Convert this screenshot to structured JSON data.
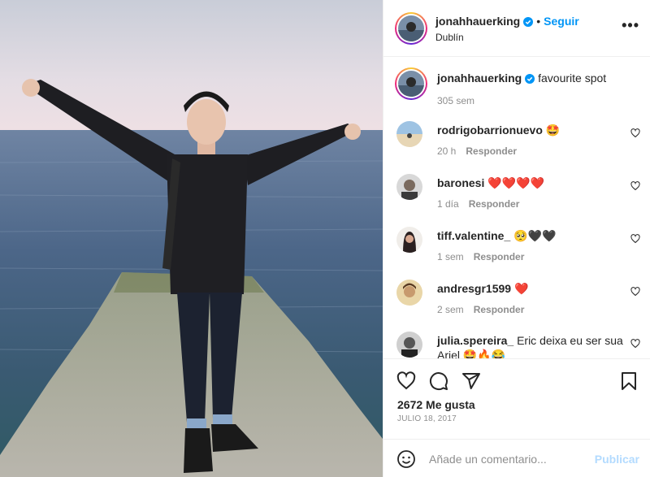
{
  "post": {
    "author": "jonahhauerking",
    "follow_label": "Seguir",
    "dot": "•",
    "location": "Dublín",
    "more": "•••"
  },
  "comments": [
    {
      "user": "jonahhauerking",
      "text": "favourite spot",
      "time": "305 sem",
      "reply": ""
    },
    {
      "user": "rodrigobarrionuevo",
      "text": "🤩",
      "time": "20 h",
      "reply": "Responder"
    },
    {
      "user": "baronesi",
      "text": "❤️❤️❤️❤️",
      "time": "1 día",
      "reply": "Responder"
    },
    {
      "user": "tiff.valentine_",
      "text": "🥺🖤🖤",
      "time": "1 sem",
      "reply": "Responder"
    },
    {
      "user": "andresgr1599",
      "text": "❤️",
      "time": "2 sem",
      "reply": "Responder"
    },
    {
      "user": "julia.spereira_",
      "text": "Eric deixa eu ser sua Ariel 🤩🔥😂",
      "time": "",
      "reply": ""
    }
  ],
  "footer": {
    "likes": "2672 Me gusta",
    "date": "JULIO 18, 2017",
    "comment_placeholder": "Añade un comentario...",
    "publish_label": "Publicar"
  },
  "icons": {
    "verified": "verified-badge-icon",
    "like": "heart-icon",
    "comment": "comment-icon",
    "share": "share-icon",
    "save": "bookmark-icon",
    "emoji": "emoji-icon"
  },
  "colors": {
    "link_blue": "#0095f6",
    "publish_disabled": "#b3dbff",
    "meta_gray": "#8e8e8e"
  }
}
